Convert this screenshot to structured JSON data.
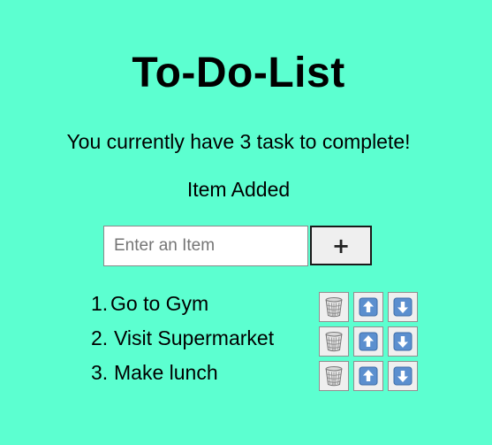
{
  "app": {
    "title": "To-Do-List",
    "subtitle": "You currently have 3 task to complete!",
    "status": "Item Added"
  },
  "form": {
    "placeholder": "Enter an Item",
    "value": "",
    "add_label": "+"
  },
  "items": [
    {
      "number": "1.",
      "text": "Go to Gym"
    },
    {
      "number": "2.",
      "text": "Visit Supermarket"
    },
    {
      "number": "3.",
      "text": "Make lunch"
    }
  ],
  "icons": {
    "delete": "wastebasket-icon",
    "up": "arrow-up-icon",
    "down": "arrow-down-icon"
  },
  "colors": {
    "background": "#5cffd0",
    "arrow_button": "#5b8fcf"
  }
}
